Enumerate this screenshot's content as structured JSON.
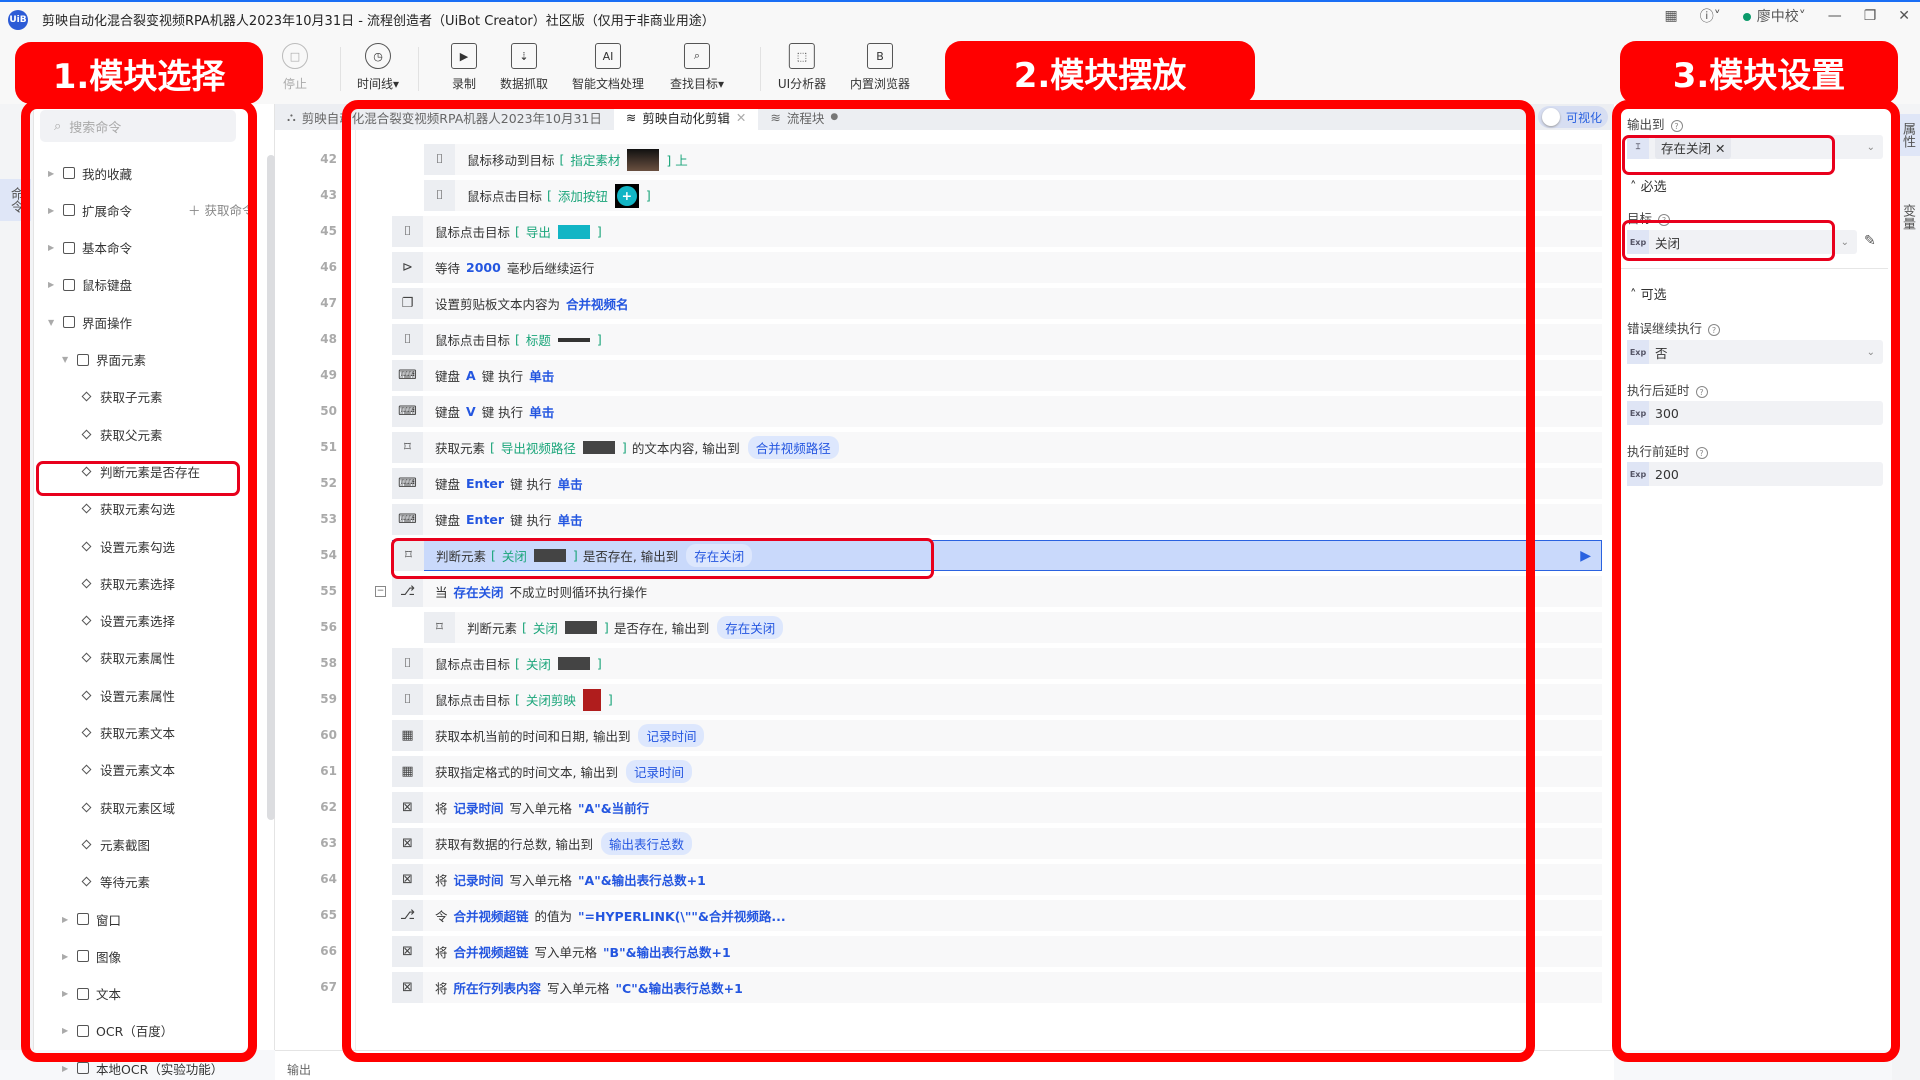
{
  "window": {
    "title": "剪映自动化混合裂变视频RPA机器人2023年10月31日 - 流程创造者（UiBot Creator）社区版（仅用于非商业用途）",
    "logo": "UiB",
    "user": "廖中校"
  },
  "toolbar": [
    {
      "label": "停止",
      "icon": "stop-icon",
      "glyph": "□",
      "disabled": true
    },
    {
      "label": "时间线▾",
      "icon": "clock-icon",
      "glyph": "◷"
    },
    {
      "label": "录制",
      "icon": "record-icon",
      "glyph": "▶"
    },
    {
      "label": "数据抓取",
      "icon": "data-scrape-icon",
      "glyph": "⇣"
    },
    {
      "label": "智能文档处理",
      "icon": "ai-doc-icon",
      "glyph": "AI"
    },
    {
      "label": "查找目标▾",
      "icon": "find-target-icon",
      "glyph": "⌕"
    },
    {
      "label": "UI分析器",
      "icon": "ui-analyzer-icon",
      "glyph": "⬚"
    },
    {
      "label": "内置浏览器",
      "icon": "browser-icon",
      "glyph": "B"
    }
  ],
  "leftstrip": {
    "commands": "命令"
  },
  "commands": {
    "search_placeholder": "搜索命令",
    "get_commands": "获取命令",
    "tree": [
      {
        "label": "我的收藏",
        "level": 0,
        "type": "group"
      },
      {
        "label": "扩展命令",
        "level": 0,
        "type": "group"
      },
      {
        "label": "基本命令",
        "level": 0,
        "type": "group"
      },
      {
        "label": "鼠标键盘",
        "level": 0,
        "type": "group"
      },
      {
        "label": "界面操作",
        "level": 0,
        "type": "open"
      },
      {
        "label": "界面元素",
        "level": 1,
        "type": "open"
      },
      {
        "label": "获取子元素",
        "level": 2,
        "type": "item"
      },
      {
        "label": "获取父元素",
        "level": 2,
        "type": "item"
      },
      {
        "label": "判断元素是否存在",
        "level": 2,
        "type": "item"
      },
      {
        "label": "获取元素勾选",
        "level": 2,
        "type": "item"
      },
      {
        "label": "设置元素勾选",
        "level": 2,
        "type": "item"
      },
      {
        "label": "获取元素选择",
        "level": 2,
        "type": "item"
      },
      {
        "label": "设置元素选择",
        "level": 2,
        "type": "item"
      },
      {
        "label": "获取元素属性",
        "level": 2,
        "type": "item"
      },
      {
        "label": "设置元素属性",
        "level": 2,
        "type": "item"
      },
      {
        "label": "获取元素文本",
        "level": 2,
        "type": "item"
      },
      {
        "label": "设置元素文本",
        "level": 2,
        "type": "item"
      },
      {
        "label": "获取元素区域",
        "level": 2,
        "type": "item"
      },
      {
        "label": "元素截图",
        "level": 2,
        "type": "item"
      },
      {
        "label": "等待元素",
        "level": 2,
        "type": "item"
      },
      {
        "label": "窗口",
        "level": 1,
        "type": "group"
      },
      {
        "label": "图像",
        "level": 1,
        "type": "group"
      },
      {
        "label": "文本",
        "level": 1,
        "type": "group"
      },
      {
        "label": "OCR（百度）",
        "level": 1,
        "type": "group"
      },
      {
        "label": "本地OCR（实验功能）",
        "level": 1,
        "type": "group"
      }
    ]
  },
  "tabs": [
    {
      "label": "剪映自动化混合裂变视频RPA机器人2023年10月31日",
      "icon": "flow-icon"
    },
    {
      "label": "剪映自动化剪辑",
      "icon": "layers-icon",
      "active": true,
      "closable": true
    },
    {
      "label": "流程块",
      "icon": "layers-icon",
      "dot": true
    }
  ],
  "visualize_toggle": "可视化",
  "rows": [
    {
      "n": "42",
      "icon": "mouse",
      "nest": true,
      "parts": [
        [
          "鼠标移动到目标",
          ""
        ],
        [
          "[",
          "t"
        ],
        [
          "指定素材",
          "t"
        ],
        [
          "img",
          "th"
        ],
        [
          "] 上",
          "t2"
        ]
      ]
    },
    {
      "n": "43",
      "icon": "mouse",
      "nest": true,
      "parts": [
        [
          "鼠标点击目标",
          ""
        ],
        [
          "[",
          "t"
        ],
        [
          "添加按钮",
          "t"
        ],
        [
          "plus",
          "th"
        ],
        [
          "]",
          "t"
        ]
      ]
    },
    {
      "n": "45",
      "icon": "mouse",
      "parts": [
        [
          "鼠标点击目标",
          ""
        ],
        [
          "[",
          "t"
        ],
        [
          "导出",
          "t"
        ],
        [
          "export",
          "th"
        ],
        [
          "]",
          "t"
        ]
      ]
    },
    {
      "n": "46",
      "icon": "terminal",
      "parts": [
        [
          "等待",
          ""
        ],
        [
          "2000",
          "v"
        ],
        [
          "毫秒后继续运行",
          ""
        ]
      ]
    },
    {
      "n": "47",
      "icon": "clipboard",
      "parts": [
        [
          "设置剪贴板文本内容为",
          ""
        ],
        [
          "合并视频名",
          "v"
        ]
      ]
    },
    {
      "n": "48",
      "icon": "mouse",
      "parts": [
        [
          "鼠标点击目标",
          ""
        ],
        [
          "[",
          "t"
        ],
        [
          "标题",
          "t"
        ],
        [
          "line",
          "th"
        ],
        [
          "]",
          "t"
        ]
      ]
    },
    {
      "n": "49",
      "icon": "keyboard",
      "parts": [
        [
          "键盘",
          ""
        ],
        [
          "A",
          "v"
        ],
        [
          "键 执行",
          ""
        ],
        [
          "单击",
          "v"
        ]
      ]
    },
    {
      "n": "50",
      "icon": "keyboard",
      "parts": [
        [
          "键盘",
          ""
        ],
        [
          "V",
          "v"
        ],
        [
          "键 执行",
          ""
        ],
        [
          "单击",
          "v"
        ]
      ]
    },
    {
      "n": "51",
      "icon": "element",
      "parts": [
        [
          "获取元素",
          ""
        ],
        [
          "[",
          "t"
        ],
        [
          "导出视频路径",
          "t"
        ],
        [
          "dark",
          "th"
        ],
        [
          "]",
          "t"
        ],
        [
          "的文本内容, 输出到",
          ""
        ],
        [
          "合并视频路径",
          "p"
        ]
      ]
    },
    {
      "n": "52",
      "icon": "keyboard",
      "parts": [
        [
          "键盘",
          ""
        ],
        [
          "Enter",
          "v"
        ],
        [
          "键 执行",
          ""
        ],
        [
          "单击",
          "v"
        ]
      ]
    },
    {
      "n": "53",
      "icon": "keyboard",
      "parts": [
        [
          "键盘",
          ""
        ],
        [
          "Enter",
          "v"
        ],
        [
          "键 执行",
          ""
        ],
        [
          "单击",
          "v"
        ]
      ]
    },
    {
      "n": "54",
      "icon": "element",
      "selected": true,
      "parts": [
        [
          "判断元素",
          ""
        ],
        [
          "[",
          "t"
        ],
        [
          "关闭",
          "t"
        ],
        [
          "dark",
          "th"
        ],
        [
          "]",
          "t"
        ],
        [
          "是否存在, 输出到",
          ""
        ],
        [
          "存在关闭",
          "p"
        ]
      ]
    },
    {
      "n": "55",
      "icon": "loop",
      "collapse": true,
      "parts": [
        [
          "当",
          ""
        ],
        [
          "存在关闭",
          "v"
        ],
        [
          "不成立时则循环执行操作",
          ""
        ]
      ]
    },
    {
      "n": "56",
      "icon": "element",
      "nest": true,
      "parts": [
        [
          "判断元素",
          ""
        ],
        [
          "[",
          "t"
        ],
        [
          "关闭",
          "t"
        ],
        [
          "dark",
          "th"
        ],
        [
          "]",
          "t"
        ],
        [
          "是否存在, 输出到",
          ""
        ],
        [
          "存在关闭",
          "p"
        ]
      ]
    },
    {
      "n": "58",
      "icon": "mouse",
      "parts": [
        [
          "鼠标点击目标",
          ""
        ],
        [
          "[",
          "t"
        ],
        [
          "关闭",
          "t"
        ],
        [
          "dark",
          "th"
        ],
        [
          "]",
          "t"
        ]
      ]
    },
    {
      "n": "59",
      "icon": "mouse",
      "parts": [
        [
          "鼠标点击目标",
          ""
        ],
        [
          "[",
          "t"
        ],
        [
          "关闭剪映",
          "t"
        ],
        [
          "x",
          "th"
        ],
        [
          "]",
          "t"
        ]
      ]
    },
    {
      "n": "60",
      "icon": "calendar",
      "parts": [
        [
          "获取本机当前的时间和日期, 输出到",
          ""
        ],
        [
          "记录时间",
          "p"
        ]
      ]
    },
    {
      "n": "61",
      "icon": "calendar",
      "parts": [
        [
          "获取指定格式的时间文本, 输出到",
          ""
        ],
        [
          "记录时间",
          "p"
        ]
      ]
    },
    {
      "n": "62",
      "icon": "excel",
      "parts": [
        [
          "将",
          ""
        ],
        [
          "记录时间",
          "v"
        ],
        [
          "写入单元格",
          ""
        ],
        [
          "\"A\"&当前行",
          "v"
        ]
      ]
    },
    {
      "n": "63",
      "icon": "excel",
      "parts": [
        [
          "获取有数据的行总数, 输出到",
          ""
        ],
        [
          "输出表行总数",
          "p"
        ]
      ]
    },
    {
      "n": "64",
      "icon": "excel",
      "parts": [
        [
          "将",
          ""
        ],
        [
          "记录时间",
          "v"
        ],
        [
          "写入单元格",
          ""
        ],
        [
          "\"A\"&输出表行总数+1",
          "v"
        ]
      ]
    },
    {
      "n": "65",
      "icon": "loop",
      "parts": [
        [
          "令",
          ""
        ],
        [
          "合并视频超链",
          "v"
        ],
        [
          "的值为",
          ""
        ],
        [
          "\"=HYPERLINK(\\\"\"&合并视频路...",
          "v"
        ]
      ]
    },
    {
      "n": "66",
      "icon": "excel",
      "parts": [
        [
          "将",
          ""
        ],
        [
          "合并视频超链",
          "v"
        ],
        [
          "写入单元格",
          ""
        ],
        [
          "\"B\"&输出表行总数+1",
          "v"
        ]
      ]
    },
    {
      "n": "67",
      "icon": "excel",
      "parts": [
        [
          "将",
          ""
        ],
        [
          "所在行列表内容",
          "v"
        ],
        [
          "写入单元格",
          ""
        ],
        [
          "\"C\"&输出表行总数+1",
          "v"
        ]
      ]
    }
  ],
  "output_tab": "输出",
  "props": {
    "output_label": "输出到",
    "output_value": "存在关闭",
    "required": "必选",
    "target_label": "目标",
    "target_value": "关闭",
    "optional": "可选",
    "error_label": "错误继续执行",
    "error_value": "否",
    "after_label": "执行后延时",
    "after_value": "300",
    "before_label": "执行前延时",
    "before_value": "200",
    "exp": "Exp"
  },
  "rightstrip": {
    "props": "属性",
    "vars": "变量"
  },
  "annotations": {
    "a1": "1.模块选择",
    "a2": "2.模块摆放",
    "a3": "3.模块设置"
  },
  "colors": {
    "annotation": "#ff0000",
    "accent": "#2a62e0",
    "target": "#1aa57a",
    "selected_row": "#c9d9fb"
  }
}
